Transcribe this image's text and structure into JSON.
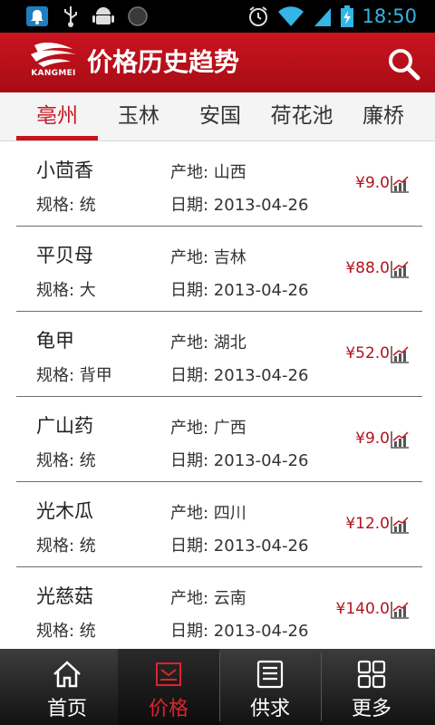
{
  "status_bar": {
    "time": "18:50",
    "icons": [
      "notification-icon",
      "usb-icon",
      "android-icon",
      "record-icon",
      "alarm-icon",
      "wifi-icon",
      "signal-icon",
      "battery-charging-icon"
    ]
  },
  "header": {
    "logo_text": "KANGMEI",
    "title": "价格历史趋势",
    "search_icon": "search-icon"
  },
  "tabs": [
    {
      "label": "亳州"
    },
    {
      "label": "玉林"
    },
    {
      "label": "安国"
    },
    {
      "label": "荷花池"
    },
    {
      "label": "廉桥"
    }
  ],
  "active_tab": "亳州",
  "items": [
    {
      "name": "小茴香",
      "spec": "规格: 统",
      "origin": "产地: 山西",
      "date": "日期: 2013-04-26",
      "price": "¥9.0"
    },
    {
      "name": "平贝母",
      "spec": "规格: 大",
      "origin": "产地: 吉林",
      "date": "日期: 2013-04-26",
      "price": "¥88.0"
    },
    {
      "name": "龟甲",
      "spec": "规格: 背甲",
      "origin": "产地: 湖北",
      "date": "日期: 2013-04-26",
      "price": "¥52.0"
    },
    {
      "name": "广山药",
      "spec": "规格: 统",
      "origin": "产地: 广西",
      "date": "日期: 2013-04-26",
      "price": "¥9.0"
    },
    {
      "name": "光木瓜",
      "spec": "规格: 统",
      "origin": "产地: 四川",
      "date": "日期: 2013-04-26",
      "price": "¥12.0"
    },
    {
      "name": "光慈菇",
      "spec": "规格: 统",
      "origin": "产地: 云南",
      "date": "日期: 2013-04-26",
      "price": "¥140.0"
    }
  ],
  "bottom_nav": [
    {
      "label": "首页",
      "icon": "home-icon"
    },
    {
      "label": "价格",
      "icon": "price-icon"
    },
    {
      "label": "供求",
      "icon": "list-icon"
    },
    {
      "label": "更多",
      "icon": "grid-icon"
    }
  ],
  "active_nav": "价格",
  "colors": {
    "brand_red": "#c8141f",
    "price_red": "#b3121c",
    "status_blue": "#33b5e5",
    "nav_bg": "#1e1e1e"
  }
}
